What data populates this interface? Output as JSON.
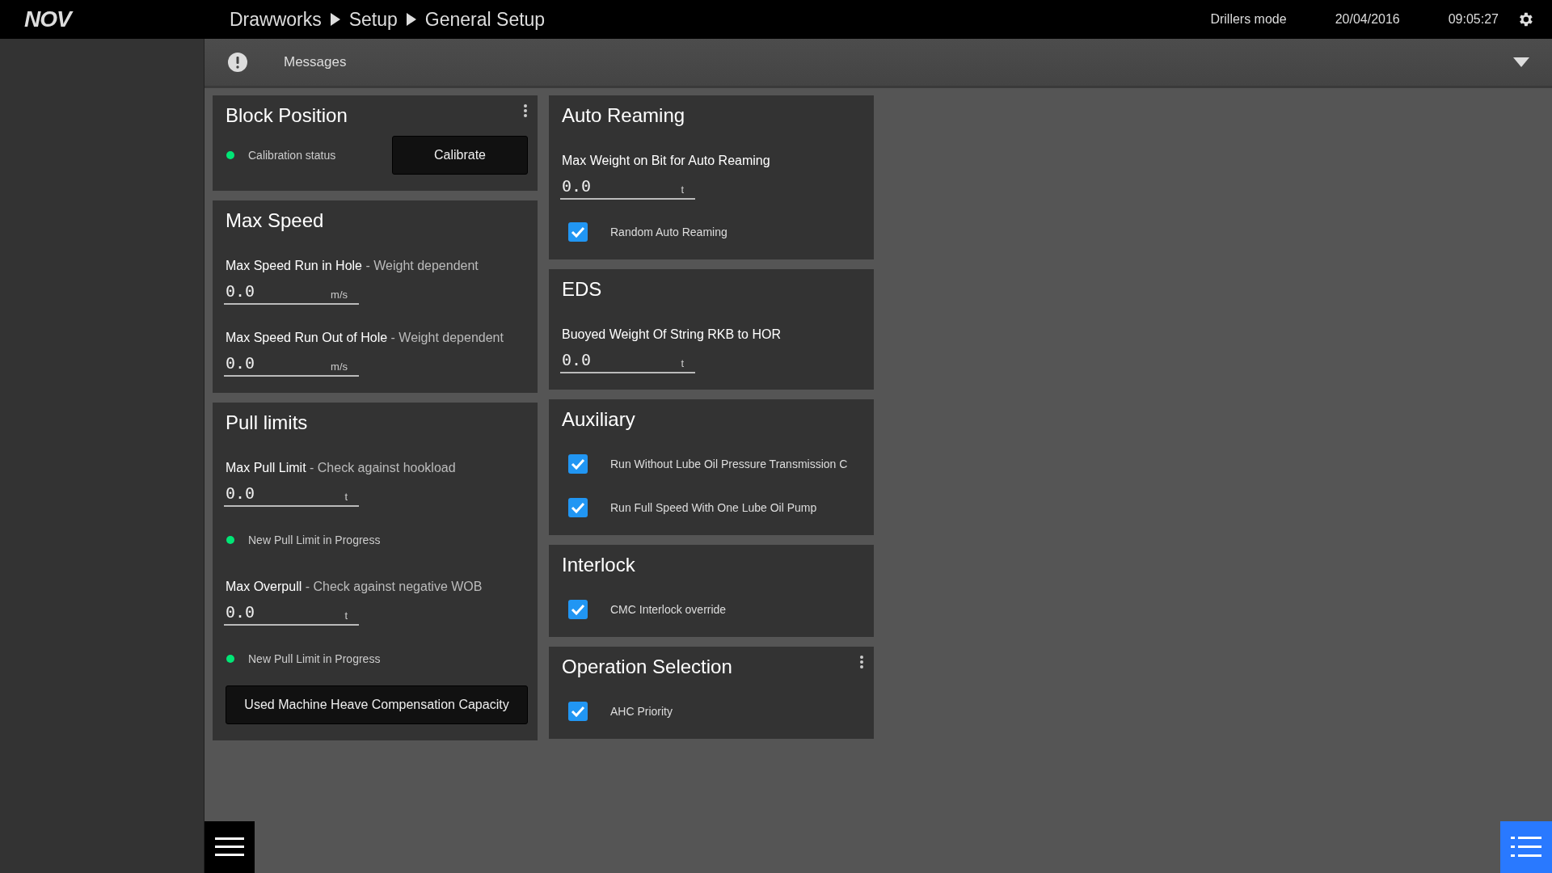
{
  "topbar": {
    "logo": "NOV",
    "breadcrumbs": [
      "Drawworks",
      "Setup",
      "General Setup"
    ],
    "mode": "Drillers mode",
    "date": "20/04/2016",
    "time": "09:05:27"
  },
  "messages": {
    "label": "Messages"
  },
  "columns": [
    [
      {
        "title": "Block Position",
        "menu": true,
        "items": [
          {
            "kind": "status_button",
            "status": "Calibration status",
            "color": "#00e676",
            "button": "Calibrate"
          }
        ]
      },
      {
        "title": "Max Speed",
        "menu": false,
        "items": [
          {
            "kind": "field",
            "label": "Max Speed Run in Hole",
            "hint": "- Weight dependent",
            "value": "0.0",
            "unit": "m/s"
          },
          {
            "kind": "field",
            "label": "Max Speed Run Out of Hole",
            "hint": "- Weight dependent",
            "value": "0.0",
            "unit": "m/s"
          }
        ]
      },
      {
        "title": "Pull limits",
        "menu": false,
        "items": [
          {
            "kind": "field",
            "label": "Max Pull Limit",
            "hint": "- Check against hookload",
            "value": "0.0",
            "unit": "t"
          },
          {
            "kind": "status",
            "status": "New Pull Limit in Progress",
            "color": "#00e676"
          },
          {
            "kind": "field",
            "label": "Max Overpull",
            "hint": "- Check against negative WOB",
            "value": "0.0",
            "unit": "t"
          },
          {
            "kind": "status",
            "status": "New Pull Limit in Progress",
            "color": "#00e676"
          },
          {
            "kind": "button",
            "button": "Used Machine Heave Compensation Capacity"
          }
        ]
      }
    ],
    [
      {
        "title": "Auto Reaming",
        "menu": false,
        "items": [
          {
            "kind": "field",
            "label": "Max Weight on Bit for Auto Reaming",
            "value": "0.0",
            "unit": "t"
          },
          {
            "kind": "checkbox",
            "label": "Random Auto Reaming",
            "checked": true
          }
        ]
      },
      {
        "title": "EDS",
        "menu": false,
        "items": [
          {
            "kind": "field",
            "label": "Buoyed Weight Of String RKB to HOR",
            "value": "0.0",
            "unit": "t"
          }
        ]
      },
      {
        "title": "Auxiliary",
        "menu": false,
        "items": [
          {
            "kind": "checkbox",
            "label": "Run Without Lube Oil Pressure Transmission C",
            "checked": true
          },
          {
            "kind": "checkbox",
            "label": "Run Full Speed With One Lube Oil Pump",
            "checked": true
          }
        ]
      },
      {
        "title": "Interlock",
        "menu": false,
        "items": [
          {
            "kind": "checkbox",
            "label": "CMC Interlock override",
            "checked": true
          }
        ]
      },
      {
        "title": "Operation Selection",
        "menu": true,
        "items": [
          {
            "kind": "checkbox",
            "label": "AHC Priority",
            "checked": true
          }
        ]
      }
    ]
  ]
}
